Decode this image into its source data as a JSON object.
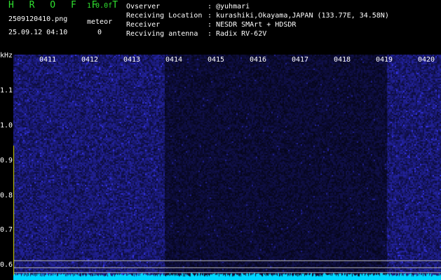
{
  "header": {
    "brand": "H R O F F T",
    "version": "1.0.0f",
    "filename": "2509120410.png",
    "meteor_label": "meteor",
    "datetime": "25.09.12 04:10",
    "meteor_count": "0"
  },
  "info": [
    {
      "key": "Ovserver",
      "value": "@yuhmari"
    },
    {
      "key": "Receiving Location",
      "value": "kurashiki,Okayama,JAPAN (133.77E, 34.58N)"
    },
    {
      "key": "Receiver",
      "value": "NESDR SMArt + HDSDR"
    },
    {
      "key": "Recviving antenna",
      "value": "Radix RV-62V"
    }
  ],
  "chart_data": {
    "type": "heatmap",
    "ylabel": "kHz",
    "y_ticks": [
      "1.1",
      "1.0",
      "0.9",
      "0.8",
      "0.7",
      "0.6"
    ],
    "y_tick_values": [
      1.1,
      1.0,
      0.9,
      0.8,
      0.7,
      0.6
    ],
    "ylim": [
      0.56,
      1.2
    ],
    "x_ticks": [
      "0411",
      "0412",
      "0413",
      "0414",
      "0415",
      "0416",
      "0417",
      "0418",
      "0419",
      "0420"
    ],
    "xlim_minutes": [
      0,
      10
    ],
    "reference_lines_khz": [
      0.615,
      0.595,
      0.58
    ],
    "colors": {
      "bright_noise": "#1e1e8c",
      "dim_noise": "#0c0c3a",
      "trace": "#00d8ff",
      "label": "#2fe12f"
    }
  }
}
